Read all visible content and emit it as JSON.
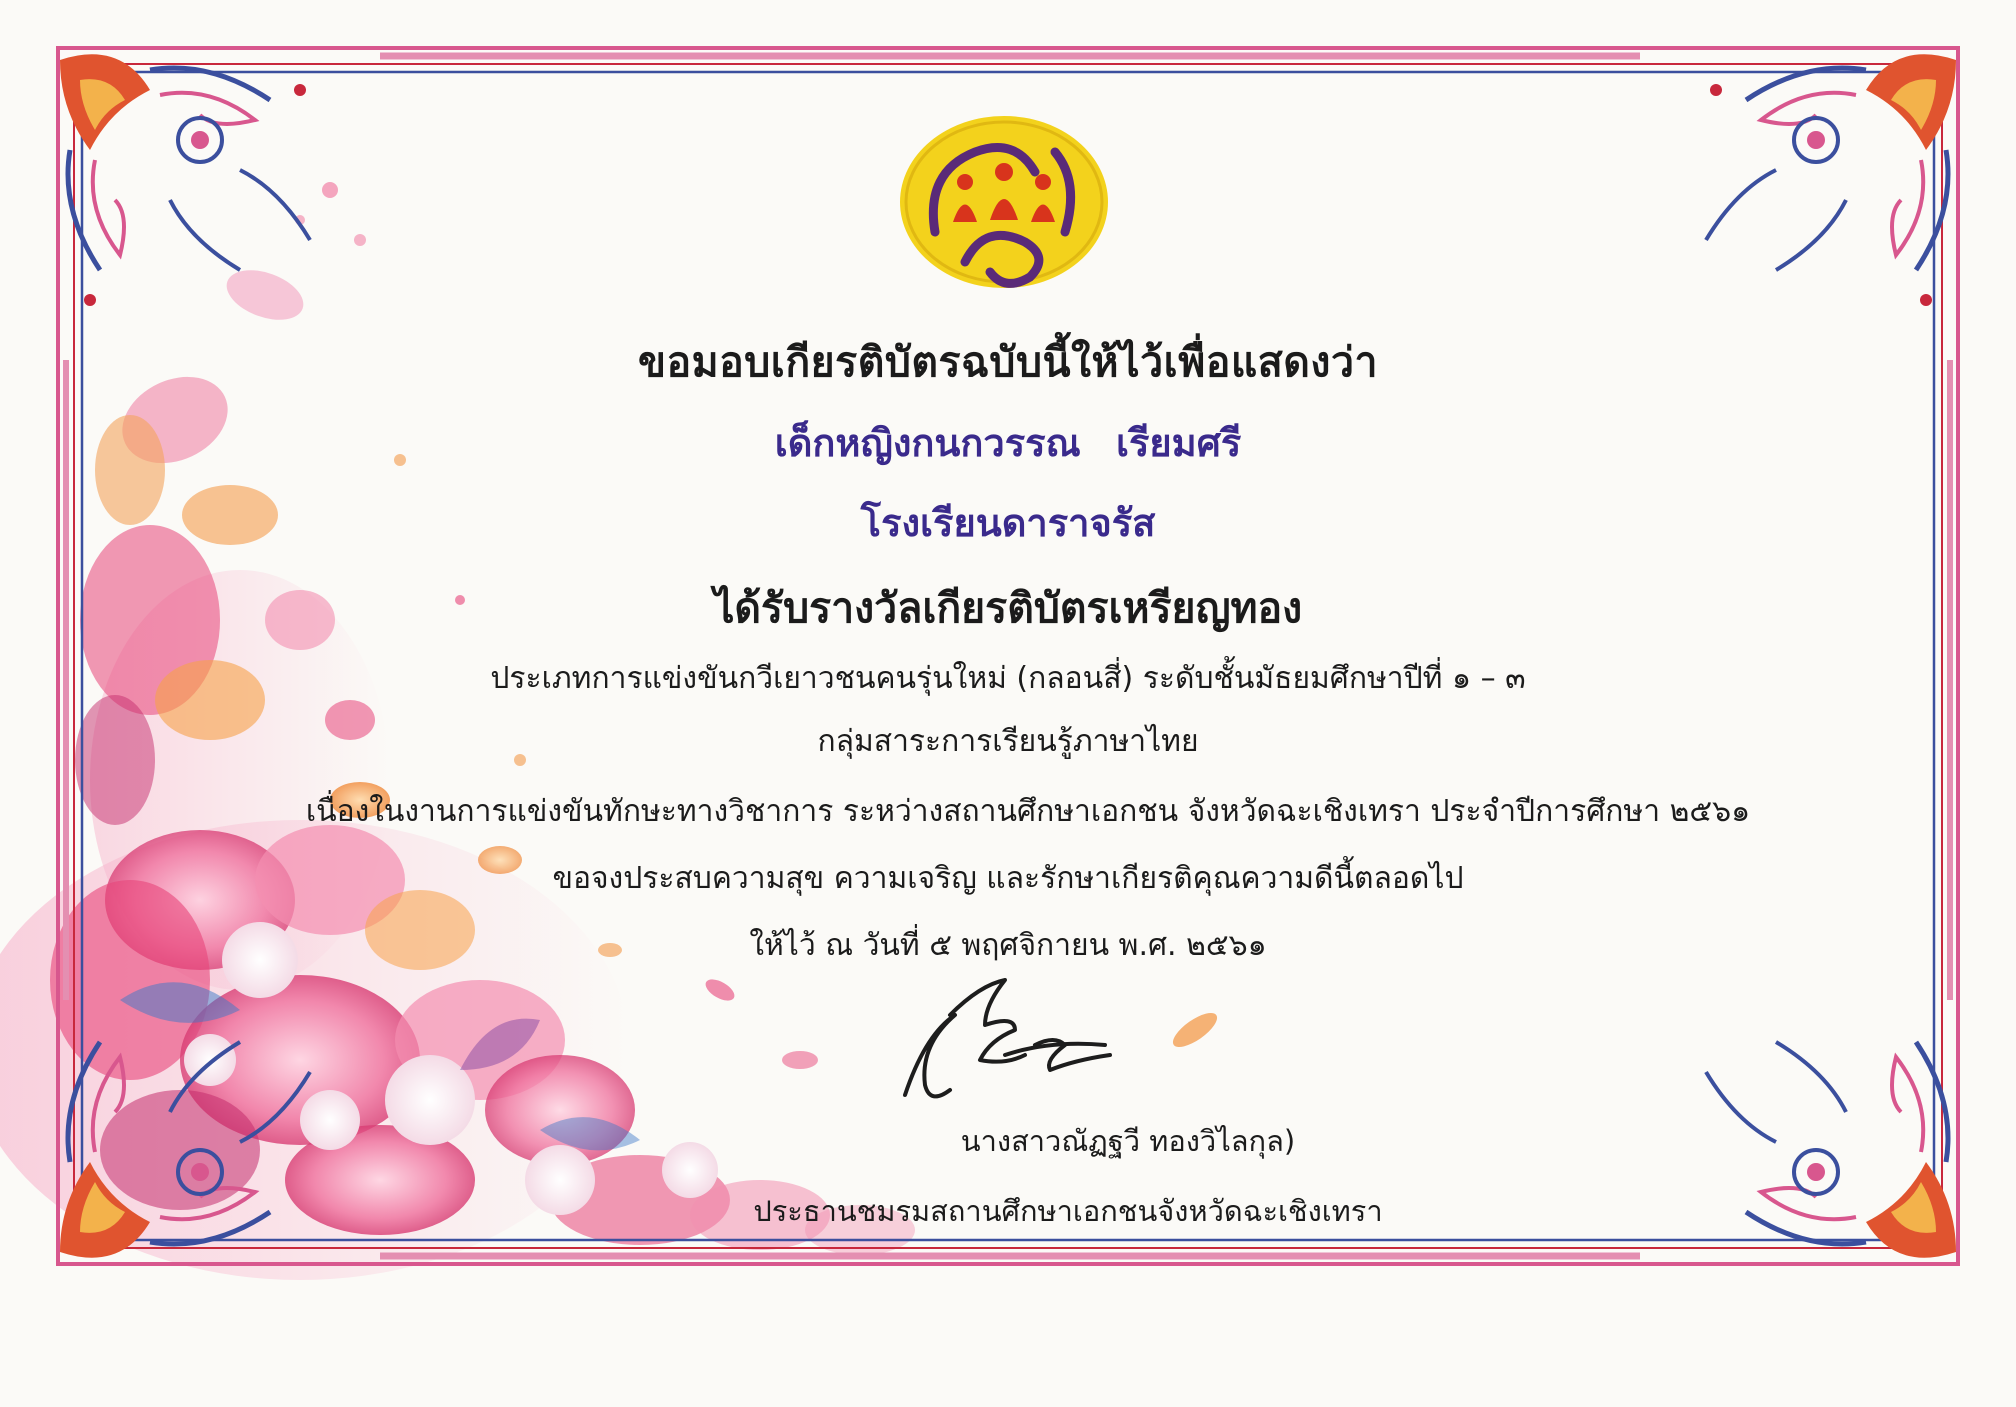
{
  "certificate": {
    "heading": "ขอมอบเกียรติบัตรฉบับนี้ให้ไว้เพื่อแสดงว่า",
    "recipient": "เด็กหญิงกนกวรรณ   เรียมศรี",
    "school": "โรงเรียนดาราจรัส",
    "award": "ได้รับรางวัลเกียรติบัตรเหรียญทอง",
    "category": "ประเภทการแข่งขันกวีเยาวชนคนรุ่นใหม่ (กลอนสี่)   ระดับชั้นมัธยมศึกษาปีที่ ๑ – ๓",
    "subject": "กลุ่มสาระการเรียนรู้ภาษาไทย",
    "occasion": "เนื่องในงานการแข่งขันทักษะทางวิชาการ ระหว่างสถานศึกษาเอกชน จังหวัดฉะเชิงเทรา ประจำปีการศึกษา ๒๕๖๑",
    "wish": "ขอจงประสบความสุข ความเจริญ และรักษาเกียรติคุณความดีนี้ตลอดไป",
    "date": "ให้ไว้ ณ วันที่  ๕  พฤศจิกายน  พ.ศ.  ๒๕๖๑",
    "signer": "นางสาวณัฏฐวี   ทองวิไลกุล)",
    "signer_title": "ประธานชมรมสถานศึกษาเอกชนจังหวัดฉะเชิงเทรา"
  },
  "logo": {
    "icon": "association-emblem-icon",
    "colors": {
      "background": "#f3d21c",
      "figures": "#d8341c",
      "script": "#5a2a78"
    }
  },
  "signature": {
    "icon": "handwritten-signature-icon",
    "color": "#1d1d1d"
  },
  "decoration": {
    "border_colors": {
      "pink": "#d8578e",
      "red": "#c8283c",
      "blue": "#3b4f9e"
    },
    "splash_colors": [
      "#e8457a",
      "#f38fb0",
      "#f7a24a",
      "#c52d6d",
      "#ffffff"
    ]
  }
}
